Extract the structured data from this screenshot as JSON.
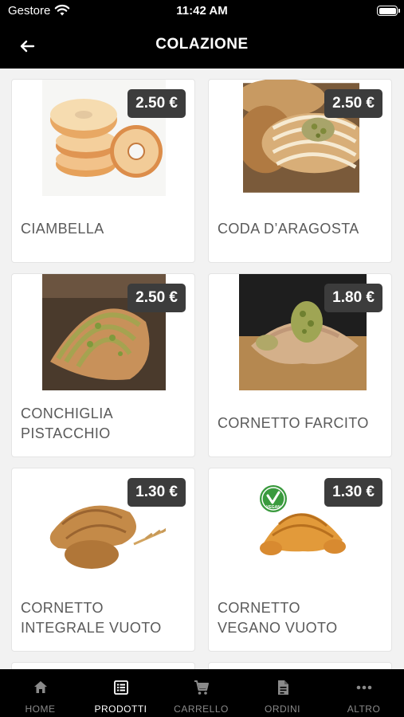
{
  "status_bar": {
    "carrier": "Gestore",
    "time": "11:42 AM"
  },
  "header": {
    "title": "COLAZIONE"
  },
  "products": [
    {
      "name_lines": [
        "CIAMBELLA"
      ],
      "price": "2.50 €"
    },
    {
      "name_lines": [
        "CODA D’ARAGOSTA"
      ],
      "price": "2.50 €"
    },
    {
      "name_lines": [
        "CONCHIGLIA",
        "PISTACCHIO"
      ],
      "price": "2.50 €"
    },
    {
      "name_lines": [
        "CORNETTO FARCITO"
      ],
      "price": "1.80 €"
    },
    {
      "name_lines": [
        "CORNETTO",
        "INTEGRALE VUOTO"
      ],
      "price": "1.30 €"
    },
    {
      "name_lines": [
        "CORNETTO",
        "VEGANO VUOTO"
      ],
      "price": "1.30 €",
      "badge": "VEGAN"
    }
  ],
  "tabs": [
    {
      "label": "HOME",
      "icon": "home-icon"
    },
    {
      "label": "PRODOTTI",
      "icon": "list-icon",
      "active": true
    },
    {
      "label": "CARRELLO",
      "icon": "cart-icon"
    },
    {
      "label": "ORDINI",
      "icon": "document-icon"
    },
    {
      "label": "ALTRO",
      "icon": "more-icon"
    }
  ],
  "colors": {
    "bar": "#000000",
    "price_badge": "#3c3c3c",
    "product_text": "#5a5a5a",
    "tab_inactive": "#8a8a8a",
    "vegan_badge": "#3a9a3e"
  }
}
